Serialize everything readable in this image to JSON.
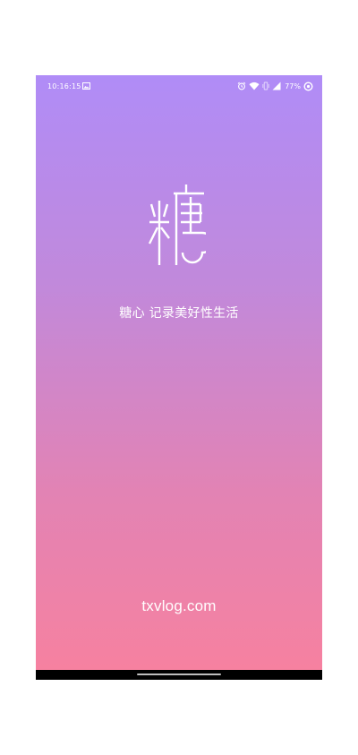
{
  "status_bar": {
    "time": "10:16:15",
    "battery_percent": "77%",
    "icons": [
      "image-icon",
      "alarm-icon",
      "wifi-icon",
      "vibrate-icon",
      "cell-signal-icon",
      "data-saver-icon"
    ]
  },
  "splash": {
    "logo_char": "糖",
    "tagline": "糖心  记录美好性生活",
    "domain": "txvlog.com",
    "gradient": {
      "top": "#b08cf7",
      "bottom": "#f681a0"
    }
  }
}
